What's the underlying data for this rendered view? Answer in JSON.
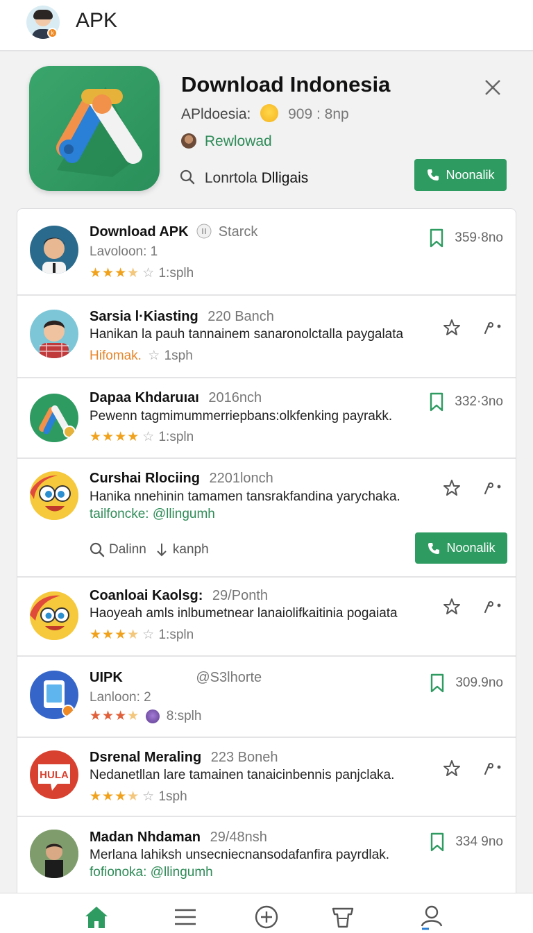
{
  "header": {
    "title": "APK"
  },
  "hero": {
    "title": "Download Indonesia",
    "subtitle_prefix": "APldoesia:",
    "subtitle_count": "909 : 8np",
    "reload_label": "Rewlowad",
    "search_text": "Lonrtola",
    "search_text_bold": "Dlligais",
    "button_label": "Noonalik"
  },
  "items": [
    {
      "title": "Download APK",
      "meta": "Starck",
      "line2": "Lavoloon: 1",
      "line3_text": "1:splh",
      "count": "359·8no"
    },
    {
      "title": "Sarsia l·Kiasting",
      "meta": "220 Banch",
      "line2": "Hanikan la pauh tannainem sanaronolctalla paygalata",
      "line3_highlight": "Hifomak.",
      "line3_text": "1sph"
    },
    {
      "title": "Dapaa Khdaruıaı",
      "meta": "2016nch",
      "line2": "Pewenn tagmimummerriepbans:olkfenking payrakk.",
      "line3_text": "1:spln",
      "count": "332·3no"
    },
    {
      "title": "Curshai Rlociing",
      "meta": "2201lonch",
      "line2": "Hanika nnehinin tamamen tansrakfandina yarychaka.",
      "line3_green": "tailfoncke: @llingumh",
      "search_a": "Dalinn",
      "search_b": "kanph",
      "button_label": "Noonalik"
    },
    {
      "title": "Coanloai Kaolsg:",
      "meta": "29/Ponth",
      "line2": "Haoyeah amls inlbumetnear lanaiolifkaitinia pogaiata",
      "line3_text": "1:spln"
    },
    {
      "title": "UIPK",
      "meta": "@S3lhorte",
      "line2": "Lanloon: 2",
      "line3_text": "8:splh",
      "count": "309.9no"
    },
    {
      "title": "Dsrenal Meraling",
      "meta": "223 Boneh",
      "line2": "Nedanetllan lare tamainen tanaicinbennis panjclaka.",
      "line3_text": "1sph",
      "badge_text": "HULA"
    },
    {
      "title": "Madan Nhdaman",
      "meta": "29/48nsh",
      "line2": "Merlana lahiksh unsecniecnansodafanfira payrdlak.",
      "line3_green": "fofionoka: @llingumh",
      "count": "334 9no"
    }
  ],
  "colors": {
    "accent": "#2e9b61",
    "star": "#f0a21c",
    "link_green": "#2e8b57"
  },
  "nav": [
    "home-icon",
    "menu-icon",
    "add-icon",
    "shop-icon",
    "profile-icon"
  ]
}
